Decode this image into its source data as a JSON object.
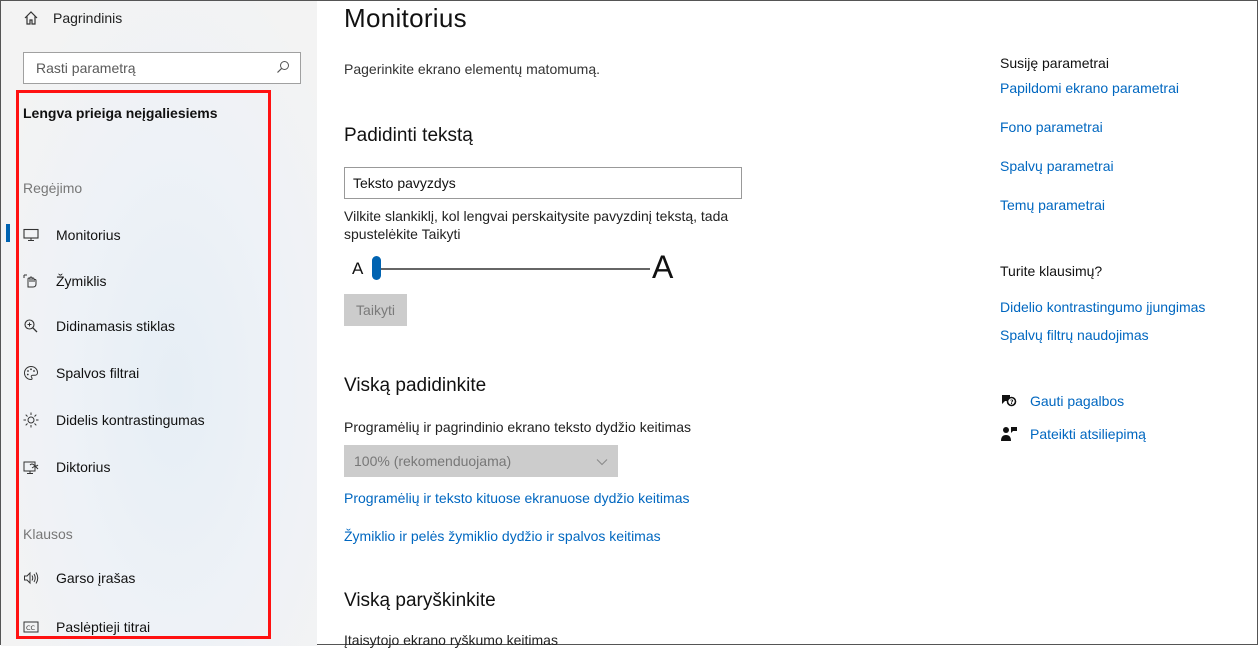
{
  "sidebar": {
    "home_label": "Pagrindinis",
    "search_placeholder": "Rasti parametrą",
    "category_title": "Lengva prieiga neįgaliesiems",
    "groups": [
      {
        "label": "Regėjimo"
      },
      {
        "label": "Klausos"
      }
    ],
    "items": [
      {
        "label": "Monitorius",
        "icon": "monitor-icon",
        "selected": true
      },
      {
        "label": "Žymiklis",
        "icon": "pointer-icon"
      },
      {
        "label": "Didinamasis stiklas",
        "icon": "magnifier-icon"
      },
      {
        "label": "Spalvos filtrai",
        "icon": "palette-icon"
      },
      {
        "label": "Didelis kontrastingumas",
        "icon": "brightness-icon"
      },
      {
        "label": "Diktorius",
        "icon": "narrator-icon"
      },
      {
        "label": "Garso įrašas",
        "icon": "speaker-icon"
      },
      {
        "label": "Paslėptieji titrai",
        "icon": "captions-icon"
      }
    ]
  },
  "main": {
    "title": "Monitorius",
    "description": "Pagerinkite ekrano elementų matomumą.",
    "enlarge_text": {
      "heading": "Padidinti tekstą",
      "sample_value": "Teksto pavyzdys",
      "instruction": "Vilkite slankiklį, kol lengvai perskaitysite pavyzdinį tekstą, tada spustelėkite Taikyti",
      "slider_small": "A",
      "slider_big": "A",
      "slider_level": 0.0,
      "apply_label": "Taikyti"
    },
    "make_bigger": {
      "heading": "Viską padidinkite",
      "label": "Programėlių ir pagrindinio ekrano teksto dydžio keitimas",
      "select_value": "100% (rekomenduojama)",
      "link1": "Programėlių ir teksto kituose ekranuose dydžio keitimas",
      "link2": "Žymiklio ir pelės žymiklio dydžio ir spalvos keitimas"
    },
    "brighter": {
      "heading": "Viską paryškinkite",
      "label": "Įtaisytojo ekrano ryškumo keitimas"
    }
  },
  "related": {
    "heading": "Susiję parametrai",
    "links": [
      "Papildomi ekrano parametrai",
      "Fono parametrai",
      "Spalvų parametrai",
      "Temų parametrai"
    ]
  },
  "questions": {
    "heading": "Turite klausimų?",
    "links": [
      "Didelio kontrastingumo įjungimas",
      "Spalvų filtrų naudojimas"
    ]
  },
  "help": {
    "get_help": "Gauti pagalbos",
    "feedback": "Pateikti atsiliepimą"
  },
  "colors": {
    "accent": "#0067c0",
    "selection_bar": "#0063b1",
    "highlight_border": "#ff1111"
  }
}
